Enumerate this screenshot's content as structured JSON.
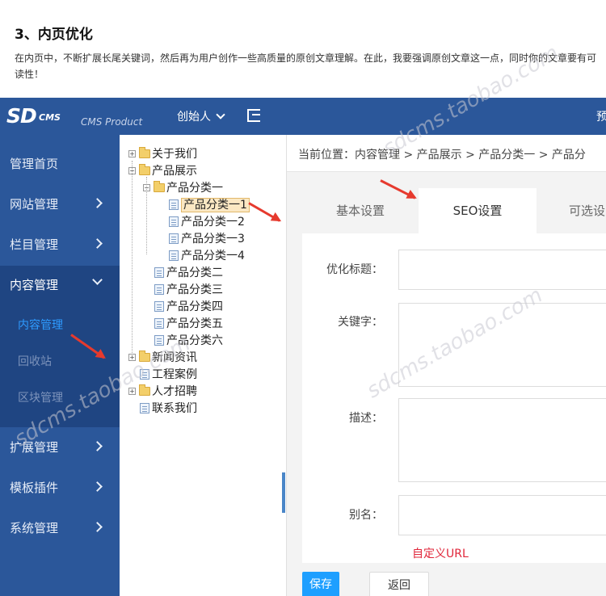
{
  "intro": {
    "heading": "3、内页优化",
    "paragraph": "在内页中，不断扩展长尾关键词，然后再为用户创作一些高质量的原创文章理解。在此，我要强调原创文章这一点，同时你的文章要有可读性！"
  },
  "topbar": {
    "logo_main": "SD",
    "logo_cms": "CMS",
    "logo_product": "CMS Product",
    "user_label": "创始人",
    "right_label": "预"
  },
  "sidebar": {
    "items": [
      {
        "label": "管理首页"
      },
      {
        "label": "网站管理"
      },
      {
        "label": "栏目管理"
      },
      {
        "label": "内容管理"
      },
      {
        "label": "扩展管理"
      },
      {
        "label": "模板插件"
      },
      {
        "label": "系统管理"
      }
    ],
    "sub_items": [
      {
        "label": "内容管理"
      },
      {
        "label": "回收站"
      },
      {
        "label": "区块管理"
      }
    ]
  },
  "tree": {
    "nodes": [
      {
        "label": "关于我们"
      },
      {
        "label": "产品展示"
      },
      {
        "label": "产品分类一"
      },
      {
        "label": "产品分类一1"
      },
      {
        "label": "产品分类一2"
      },
      {
        "label": "产品分类一3"
      },
      {
        "label": "产品分类一4"
      },
      {
        "label": "产品分类二"
      },
      {
        "label": "产品分类三"
      },
      {
        "label": "产品分类四"
      },
      {
        "label": "产品分类五"
      },
      {
        "label": "产品分类六"
      },
      {
        "label": "新闻资讯"
      },
      {
        "label": "工程案例"
      },
      {
        "label": "人才招聘"
      },
      {
        "label": "联系我们"
      }
    ]
  },
  "main": {
    "breadcrumb": "当前位置：内容管理 > 产品展示 > 产品分类一 > 产品分",
    "tabs": [
      {
        "label": "基本设置"
      },
      {
        "label": "SEO设置"
      },
      {
        "label": "可选设"
      }
    ],
    "fields": {
      "title_label": "优化标题：",
      "keywords_label": "关键字：",
      "desc_label": "描述：",
      "alias_label": "别名："
    },
    "hint": "自定义URL",
    "save_label": "保存",
    "back_label": "返回"
  },
  "watermark": "sdcms.taobao.com",
  "colors": {
    "brand": "#2b579a",
    "accent": "#1e9fff",
    "hint": "#e0263a",
    "arrow": "#e63a2e"
  }
}
